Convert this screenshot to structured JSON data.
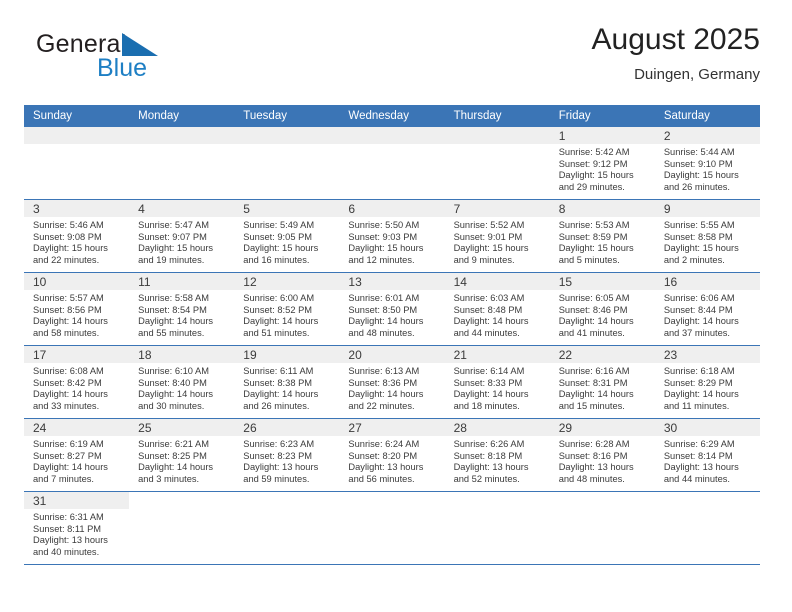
{
  "brand": {
    "name_top": "General",
    "name_bottom": "Blue",
    "flag_color": "#1a6eb0",
    "text_color": "#231f20",
    "blue_color": "#1e7fc4"
  },
  "header": {
    "title": "August 2025",
    "subtitle": "Duingen, Germany",
    "accent_color": "#3b75b6"
  },
  "calendar": {
    "day_headers": [
      "Sunday",
      "Monday",
      "Tuesday",
      "Wednesday",
      "Thursday",
      "Friday",
      "Saturday"
    ],
    "weeks": [
      [
        {
          "day": "",
          "sunrise": "",
          "sunset": "",
          "daylight1": "",
          "daylight2": "",
          "empty": true
        },
        {
          "day": "",
          "sunrise": "",
          "sunset": "",
          "daylight1": "",
          "daylight2": "",
          "empty": true
        },
        {
          "day": "",
          "sunrise": "",
          "sunset": "",
          "daylight1": "",
          "daylight2": "",
          "empty": true
        },
        {
          "day": "",
          "sunrise": "",
          "sunset": "",
          "daylight1": "",
          "daylight2": "",
          "empty": true
        },
        {
          "day": "",
          "sunrise": "",
          "sunset": "",
          "daylight1": "",
          "daylight2": "",
          "empty": true
        },
        {
          "day": "1",
          "sunrise": "Sunrise: 5:42 AM",
          "sunset": "Sunset: 9:12 PM",
          "daylight1": "Daylight: 15 hours",
          "daylight2": "and 29 minutes."
        },
        {
          "day": "2",
          "sunrise": "Sunrise: 5:44 AM",
          "sunset": "Sunset: 9:10 PM",
          "daylight1": "Daylight: 15 hours",
          "daylight2": "and 26 minutes."
        }
      ],
      [
        {
          "day": "3",
          "sunrise": "Sunrise: 5:46 AM",
          "sunset": "Sunset: 9:08 PM",
          "daylight1": "Daylight: 15 hours",
          "daylight2": "and 22 minutes."
        },
        {
          "day": "4",
          "sunrise": "Sunrise: 5:47 AM",
          "sunset": "Sunset: 9:07 PM",
          "daylight1": "Daylight: 15 hours",
          "daylight2": "and 19 minutes."
        },
        {
          "day": "5",
          "sunrise": "Sunrise: 5:49 AM",
          "sunset": "Sunset: 9:05 PM",
          "daylight1": "Daylight: 15 hours",
          "daylight2": "and 16 minutes."
        },
        {
          "day": "6",
          "sunrise": "Sunrise: 5:50 AM",
          "sunset": "Sunset: 9:03 PM",
          "daylight1": "Daylight: 15 hours",
          "daylight2": "and 12 minutes."
        },
        {
          "day": "7",
          "sunrise": "Sunrise: 5:52 AM",
          "sunset": "Sunset: 9:01 PM",
          "daylight1": "Daylight: 15 hours",
          "daylight2": "and 9 minutes."
        },
        {
          "day": "8",
          "sunrise": "Sunrise: 5:53 AM",
          "sunset": "Sunset: 8:59 PM",
          "daylight1": "Daylight: 15 hours",
          "daylight2": "and 5 minutes."
        },
        {
          "day": "9",
          "sunrise": "Sunrise: 5:55 AM",
          "sunset": "Sunset: 8:58 PM",
          "daylight1": "Daylight: 15 hours",
          "daylight2": "and 2 minutes."
        }
      ],
      [
        {
          "day": "10",
          "sunrise": "Sunrise: 5:57 AM",
          "sunset": "Sunset: 8:56 PM",
          "daylight1": "Daylight: 14 hours",
          "daylight2": "and 58 minutes."
        },
        {
          "day": "11",
          "sunrise": "Sunrise: 5:58 AM",
          "sunset": "Sunset: 8:54 PM",
          "daylight1": "Daylight: 14 hours",
          "daylight2": "and 55 minutes."
        },
        {
          "day": "12",
          "sunrise": "Sunrise: 6:00 AM",
          "sunset": "Sunset: 8:52 PM",
          "daylight1": "Daylight: 14 hours",
          "daylight2": "and 51 minutes."
        },
        {
          "day": "13",
          "sunrise": "Sunrise: 6:01 AM",
          "sunset": "Sunset: 8:50 PM",
          "daylight1": "Daylight: 14 hours",
          "daylight2": "and 48 minutes."
        },
        {
          "day": "14",
          "sunrise": "Sunrise: 6:03 AM",
          "sunset": "Sunset: 8:48 PM",
          "daylight1": "Daylight: 14 hours",
          "daylight2": "and 44 minutes."
        },
        {
          "day": "15",
          "sunrise": "Sunrise: 6:05 AM",
          "sunset": "Sunset: 8:46 PM",
          "daylight1": "Daylight: 14 hours",
          "daylight2": "and 41 minutes."
        },
        {
          "day": "16",
          "sunrise": "Sunrise: 6:06 AM",
          "sunset": "Sunset: 8:44 PM",
          "daylight1": "Daylight: 14 hours",
          "daylight2": "and 37 minutes."
        }
      ],
      [
        {
          "day": "17",
          "sunrise": "Sunrise: 6:08 AM",
          "sunset": "Sunset: 8:42 PM",
          "daylight1": "Daylight: 14 hours",
          "daylight2": "and 33 minutes."
        },
        {
          "day": "18",
          "sunrise": "Sunrise: 6:10 AM",
          "sunset": "Sunset: 8:40 PM",
          "daylight1": "Daylight: 14 hours",
          "daylight2": "and 30 minutes."
        },
        {
          "day": "19",
          "sunrise": "Sunrise: 6:11 AM",
          "sunset": "Sunset: 8:38 PM",
          "daylight1": "Daylight: 14 hours",
          "daylight2": "and 26 minutes."
        },
        {
          "day": "20",
          "sunrise": "Sunrise: 6:13 AM",
          "sunset": "Sunset: 8:36 PM",
          "daylight1": "Daylight: 14 hours",
          "daylight2": "and 22 minutes."
        },
        {
          "day": "21",
          "sunrise": "Sunrise: 6:14 AM",
          "sunset": "Sunset: 8:33 PM",
          "daylight1": "Daylight: 14 hours",
          "daylight2": "and 18 minutes."
        },
        {
          "day": "22",
          "sunrise": "Sunrise: 6:16 AM",
          "sunset": "Sunset: 8:31 PM",
          "daylight1": "Daylight: 14 hours",
          "daylight2": "and 15 minutes."
        },
        {
          "day": "23",
          "sunrise": "Sunrise: 6:18 AM",
          "sunset": "Sunset: 8:29 PM",
          "daylight1": "Daylight: 14 hours",
          "daylight2": "and 11 minutes."
        }
      ],
      [
        {
          "day": "24",
          "sunrise": "Sunrise: 6:19 AM",
          "sunset": "Sunset: 8:27 PM",
          "daylight1": "Daylight: 14 hours",
          "daylight2": "and 7 minutes."
        },
        {
          "day": "25",
          "sunrise": "Sunrise: 6:21 AM",
          "sunset": "Sunset: 8:25 PM",
          "daylight1": "Daylight: 14 hours",
          "daylight2": "and 3 minutes."
        },
        {
          "day": "26",
          "sunrise": "Sunrise: 6:23 AM",
          "sunset": "Sunset: 8:23 PM",
          "daylight1": "Daylight: 13 hours",
          "daylight2": "and 59 minutes."
        },
        {
          "day": "27",
          "sunrise": "Sunrise: 6:24 AM",
          "sunset": "Sunset: 8:20 PM",
          "daylight1": "Daylight: 13 hours",
          "daylight2": "and 56 minutes."
        },
        {
          "day": "28",
          "sunrise": "Sunrise: 6:26 AM",
          "sunset": "Sunset: 8:18 PM",
          "daylight1": "Daylight: 13 hours",
          "daylight2": "and 52 minutes."
        },
        {
          "day": "29",
          "sunrise": "Sunrise: 6:28 AM",
          "sunset": "Sunset: 8:16 PM",
          "daylight1": "Daylight: 13 hours",
          "daylight2": "and 48 minutes."
        },
        {
          "day": "30",
          "sunrise": "Sunrise: 6:29 AM",
          "sunset": "Sunset: 8:14 PM",
          "daylight1": "Daylight: 13 hours",
          "daylight2": "and 44 minutes."
        }
      ],
      [
        {
          "day": "31",
          "sunrise": "Sunrise: 6:31 AM",
          "sunset": "Sunset: 8:11 PM",
          "daylight1": "Daylight: 13 hours",
          "daylight2": "and 40 minutes."
        },
        {
          "day": "",
          "sunrise": "",
          "sunset": "",
          "daylight1": "",
          "daylight2": "",
          "blank_end": true
        },
        {
          "day": "",
          "sunrise": "",
          "sunset": "",
          "daylight1": "",
          "daylight2": "",
          "blank_end": true
        },
        {
          "day": "",
          "sunrise": "",
          "sunset": "",
          "daylight1": "",
          "daylight2": "",
          "blank_end": true
        },
        {
          "day": "",
          "sunrise": "",
          "sunset": "",
          "daylight1": "",
          "daylight2": "",
          "blank_end": true
        },
        {
          "day": "",
          "sunrise": "",
          "sunset": "",
          "daylight1": "",
          "daylight2": "",
          "blank_end": true
        },
        {
          "day": "",
          "sunrise": "",
          "sunset": "",
          "daylight1": "",
          "daylight2": "",
          "blank_end": true
        }
      ]
    ]
  }
}
